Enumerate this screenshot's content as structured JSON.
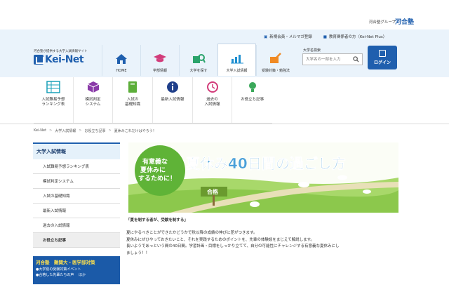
{
  "group": {
    "label": "河合塾グループ",
    "brand": "河合塾"
  },
  "util_links": [
    {
      "label": "新規会員・メルマガ登録",
      "icon": "person-plus-icon"
    },
    {
      "label": "教育関係者の方（Kei-Net Plus）",
      "icon": "lock-icon"
    }
  ],
  "brand": {
    "tagline": "河合塾が提供する大学入試情報サイト",
    "logo": "Kei-Net"
  },
  "nav": [
    {
      "label": "HOME",
      "icon": "home-icon"
    },
    {
      "label": "学部情報",
      "icon": "mortarboard-icon"
    },
    {
      "label": "大学を探す",
      "icon": "building-search-icon"
    },
    {
      "label": "大学入試情報",
      "icon": "bar-chart-icon",
      "active": true
    },
    {
      "label": "受験対策・勉強法",
      "icon": "pencil-book-icon"
    }
  ],
  "search": {
    "label": "大学名検索",
    "placeholder": "大学名の一部を入力"
  },
  "login": {
    "label": "ログイン"
  },
  "subnav": [
    {
      "label": "入試難易予想\nランキング表",
      "icon": "table-icon"
    },
    {
      "label": "模試判定\nシステム",
      "icon": "cube-icon"
    },
    {
      "label": "入試の\n基礎知識",
      "icon": "book-icon"
    },
    {
      "label": "最新入試情報",
      "icon": "info-icon"
    },
    {
      "label": "過去の\n入試情報",
      "icon": "history-icon"
    },
    {
      "label": "お役立ち記事",
      "icon": "lightbulb-icon"
    }
  ],
  "breadcrumb": [
    "Kei-Net",
    "大学入試情報",
    "お役立ち記事",
    "夏休みこれだけはやろう！"
  ],
  "sidebar": {
    "title": "大学入試情報",
    "items": [
      {
        "label": "入試難易予想ランキング表"
      },
      {
        "label": "模試判定システム"
      },
      {
        "label": "入試の基礎知識"
      },
      {
        "label": "最新入試情報"
      },
      {
        "label": "過去の入試情報"
      },
      {
        "label": "お役立ち記事",
        "current": true
      }
    ],
    "banner": {
      "title": "河合塾　難関大・医学部対策",
      "line1": "●大学別の受験対策イベント",
      "line2": "●合格した先輩たちの声 　ほか"
    }
  },
  "hero": {
    "badge_line1": "有意義な",
    "badge_line2": "夏休みに",
    "badge_line3": "するために！",
    "title": "夏休み40日間の過ごし方",
    "sign": "合格"
  },
  "article": {
    "note": "「夏を制する者が、受験を制する」",
    "lines": [
      "夏にやるべきことができたかどうかで秋以降の成績の伸びに差がつきます。",
      "夏休みにぜひやっておきたいこと、それを実践するためのポイントを、先輩の体験談をまじえて解説します。",
      "長いようであっという間の40日間。学習計画・目標をしっかり立てて、自分の可能性にチャレンジする有意義な夏休みにし",
      "ましょう！！"
    ]
  },
  "colors": {
    "brand_blue": "#1f5fae",
    "header_bg": "#eaf3fb",
    "sidebar_bg": "#e5f1fa",
    "hero_title": "#4aa0d8"
  }
}
